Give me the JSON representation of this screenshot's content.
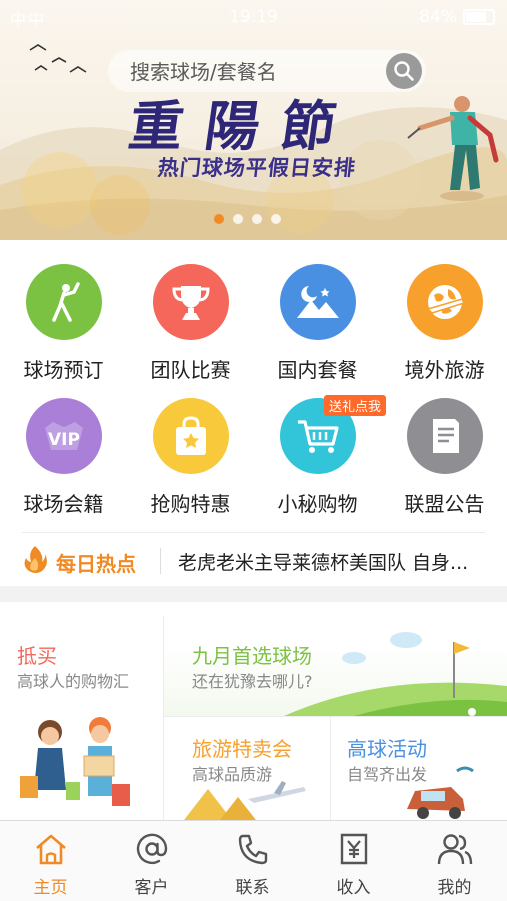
{
  "status_bar": {
    "left": "中中",
    "time": "19:19",
    "battery": "84%"
  },
  "search": {
    "placeholder": "搜索球场/套餐名"
  },
  "banner": {
    "title": "重陽節",
    "subtitle": "热门球场平假日安排",
    "dots": 4,
    "active_dot": 0
  },
  "menu": [
    {
      "label": "球场预订",
      "icon": "golfer-icon",
      "color": "#7cc242"
    },
    {
      "label": "团队比赛",
      "icon": "trophy-icon",
      "color": "#f4675a"
    },
    {
      "label": "国内套餐",
      "icon": "mountain-night-icon",
      "color": "#4a90e2"
    },
    {
      "label": "境外旅游",
      "icon": "globe-plane-icon",
      "color": "#f7a02c"
    },
    {
      "label": "球场会籍",
      "icon": "vip-icon",
      "color": "#a97fd8"
    },
    {
      "label": "抢购特惠",
      "icon": "shopping-bag-star-icon",
      "color": "#f8c93b"
    },
    {
      "label": "小秘购物",
      "icon": "cart-icon",
      "color": "#32c4d8",
      "badge": "送礼点我"
    },
    {
      "label": "联盟公告",
      "icon": "notice-doc-icon",
      "color": "#8e8e93"
    }
  ],
  "hot_news": {
    "label": "每日热点",
    "text": "老虎老米主导莱德杯美国队 自身..."
  },
  "promo": {
    "shop": {
      "title": "抵买",
      "subtitle": "高球人的购物汇"
    },
    "course": {
      "title": "九月首选球场",
      "subtitle": "还在犹豫去哪儿?"
    },
    "travel": {
      "title": "旅游特卖会",
      "subtitle": "高球品质游"
    },
    "activity": {
      "title": "高球活动",
      "subtitle": "自驾齐出发"
    }
  },
  "tabs": [
    {
      "label": "主页",
      "icon": "home-icon",
      "active": true
    },
    {
      "label": "客户",
      "icon": "at-icon",
      "active": false
    },
    {
      "label": "联系",
      "icon": "phone-icon",
      "active": false
    },
    {
      "label": "收入",
      "icon": "yen-receipt-icon",
      "active": false
    },
    {
      "label": "我的",
      "icon": "users-icon",
      "active": false
    }
  ],
  "colors": {
    "accent": "#f08a24",
    "banner_title": "#2e2777"
  }
}
